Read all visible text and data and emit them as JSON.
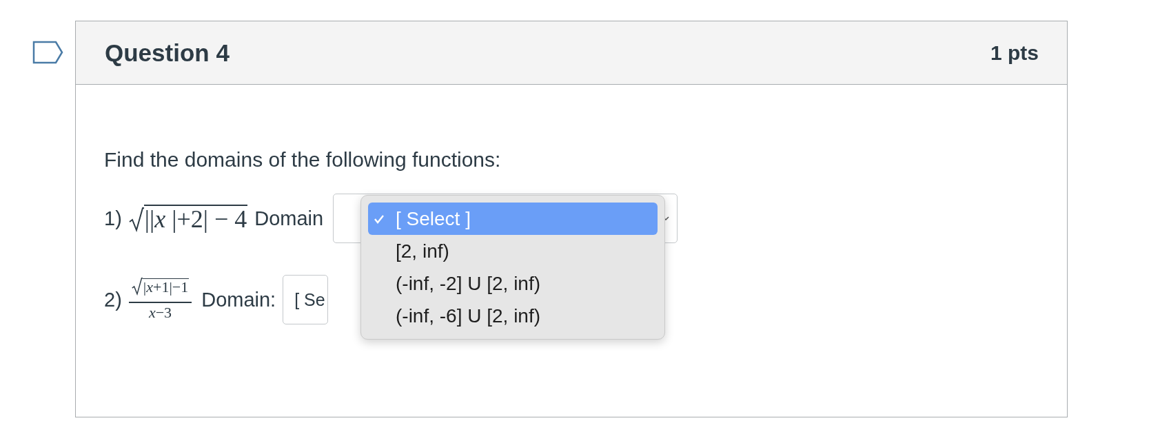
{
  "question": {
    "title": "Question 4",
    "points": "1 pts",
    "prompt": "Find the domains of the following functions:",
    "items": [
      {
        "kind": "root",
        "number": "1)",
        "radicand": "||*x* |+2| − 4",
        "label": "Domain"
      },
      {
        "kind": "fraction",
        "number": "2)",
        "radicand": "|*x*+1|−1",
        "denominator": "*x*−3",
        "label": "Domain:",
        "select_text": "[ Se"
      }
    ],
    "menu": {
      "options": [
        {
          "label": "[ Select ]",
          "selected": true
        },
        {
          "label": "[2, inf)",
          "selected": false
        },
        {
          "label": "(-inf, -2] U [2, inf)",
          "selected": false
        },
        {
          "label": "(-inf, -6] U [2, inf)",
          "selected": false
        }
      ]
    }
  }
}
